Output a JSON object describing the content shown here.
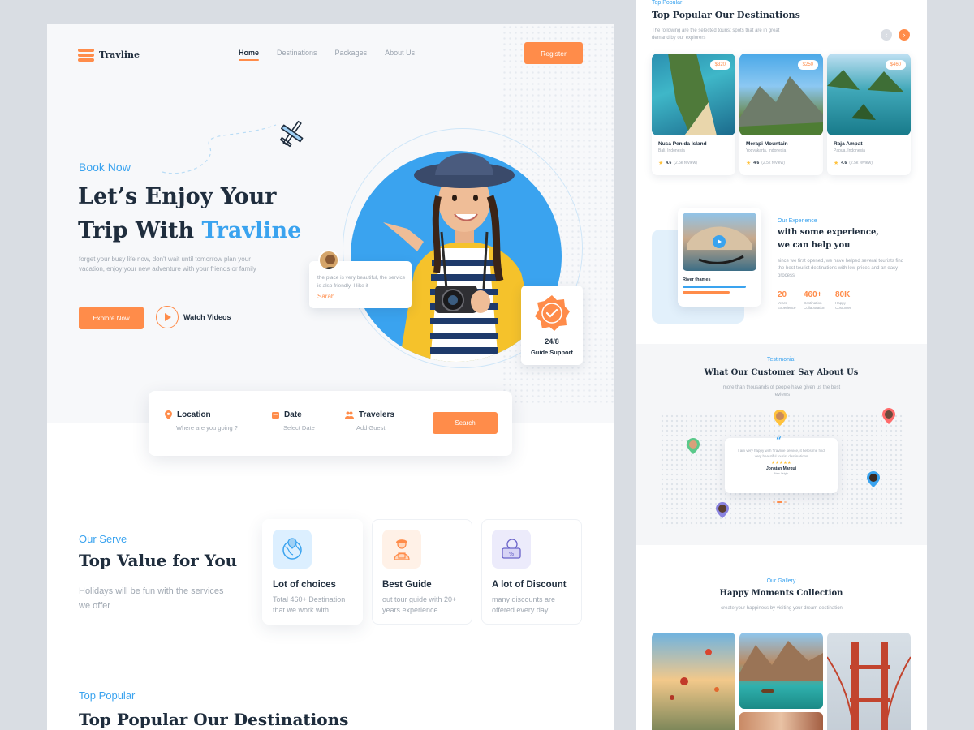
{
  "colors": {
    "accent": "#ff8c4a",
    "brand_blue": "#3aa3ef",
    "dark": "#1f2d3d",
    "muted": "#a0a8b2",
    "star": "#ffc23d"
  },
  "nav": {
    "brand": "Travline",
    "links": [
      "Home",
      "Destinations",
      "Packages",
      "About Us"
    ],
    "active": "Home",
    "register_label": "Register"
  },
  "hero": {
    "kicker": "Book Now",
    "title_line1": "Let’s Enjoy Your",
    "title_line2_prefix": "Trip With ",
    "title_line2_accent": "Travline",
    "description": "forget your busy life now, don't wait until tomorrow plan your vacation, enjoy your new adventure with your friends or family",
    "explore_label": "Explore Now",
    "watch_label": "Watch Videos",
    "review_text": "the place is very beautiful, the service is also friendly, I like it",
    "review_name": "Sarah",
    "support_number": "24/8",
    "support_label": "Guide Support"
  },
  "search": {
    "location_label": "Location",
    "location_placeholder": "Where are you going ?",
    "date_label": "Date",
    "date_placeholder": "Select Date",
    "travelers_label": "Travelers",
    "travelers_placeholder": "Add Guest",
    "search_label": "Search"
  },
  "serve": {
    "kicker": "Our Serve",
    "title": "Top Value for You",
    "description": "Holidays will be fun with the services we offer",
    "cards": [
      {
        "icon": "globe-pin-icon",
        "title": "Lot of choices",
        "desc": "Total 460+ Destination that we work with"
      },
      {
        "icon": "guide-person-icon",
        "title": "Best Guide",
        "desc": "out tour guide with 20+ years experience"
      },
      {
        "icon": "discount-ticket-icon",
        "title": "A lot of Discount",
        "desc": "many discounts are offered every day"
      }
    ]
  },
  "top_popular_left": {
    "kicker": "Top Popular",
    "title": "Top Popular Our Destinations"
  },
  "right": {
    "popular": {
      "kicker": "Top Popular",
      "title": "Top Popular Our Destinations",
      "description": "The following are the selected tourist spots that are in great demand by our explorers",
      "destinations": [
        {
          "name": "Nusa Penida Island",
          "location": "Bali, Indonesia",
          "price": "$320",
          "rating": "4.6",
          "reviews": "(2.5k review)"
        },
        {
          "name": "Merapi Mountain",
          "location": "Yogyakarta, Indonesia",
          "price": "$250",
          "rating": "4.6",
          "reviews": "(2.5k review)"
        },
        {
          "name": "Raja Ampat",
          "location": "Papua, Indonesia",
          "price": "$460",
          "rating": "4.6",
          "reviews": "(2.5k review)"
        }
      ]
    },
    "experience": {
      "card_name": "River thames",
      "kicker": "Our Experience",
      "title_line1": "with some experience,",
      "title_line2": "we can help you",
      "description": "since we first opened, we have helped several tourists find the best tourist destinations with low prices and an easy process",
      "stats": [
        {
          "value": "20",
          "label": "Years Experience"
        },
        {
          "value": "460+",
          "label": "Destination Collaboration"
        },
        {
          "value": "80K",
          "label": "Happy Costumer"
        }
      ]
    },
    "testimonial": {
      "kicker": "Testimonial",
      "title": "What Our Customer Say About Us",
      "description": "more than thousands of people have given us the best reviews",
      "quote": "I am very happy with Travline service, it helps me find very beautiful tourist destinations",
      "stars": "★★★★★",
      "name": "Jonatan Marqui",
      "role": "New Origin"
    },
    "gallery": {
      "kicker": "Our Gallery",
      "title": "Happy Moments Collection",
      "description": "create your happiness by visiting your dream destination"
    }
  }
}
